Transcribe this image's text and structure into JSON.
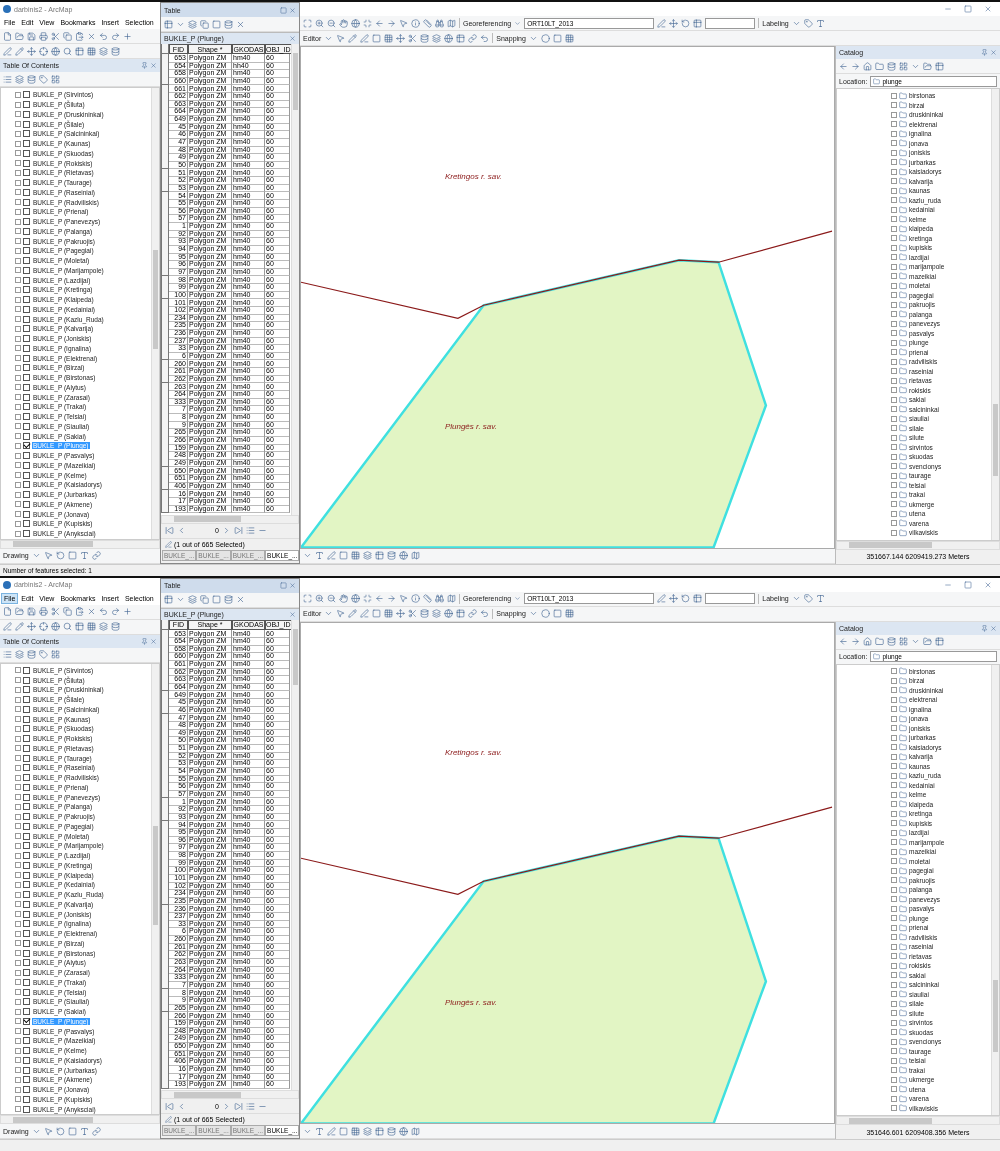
{
  "screens": [
    {
      "title": "darbinis2 - ArcMap",
      "menu": [
        {
          "label": "File",
          "selected": false
        },
        {
          "label": "Edit",
          "selected": false
        },
        {
          "label": "View",
          "selected": false
        },
        {
          "label": "Bookmarks",
          "selected": false
        },
        {
          "label": "Insert",
          "selected": false
        },
        {
          "label": "Selection",
          "selected": false
        }
      ],
      "toc": {
        "title": "Table Of Contents",
        "layers": [
          {
            "label": "BUKLE_P (Sirvintos)",
            "checked": false,
            "selected": false
          },
          {
            "label": "BUKLE_P (Šiluta)",
            "checked": false,
            "selected": false
          },
          {
            "label": "BUKLE_P (Druskininkai)",
            "checked": false,
            "selected": false
          },
          {
            "label": "BUKLE_P (Šilale)",
            "checked": false,
            "selected": false
          },
          {
            "label": "BUKLE_P (Salcininkai)",
            "checked": false,
            "selected": false
          },
          {
            "label": "BUKLE_P (Kaunas)",
            "checked": false,
            "selected": false
          },
          {
            "label": "BUKLE_P (Skuodas)",
            "checked": false,
            "selected": false
          },
          {
            "label": "BUKLE_P (Rokiskis)",
            "checked": false,
            "selected": false
          },
          {
            "label": "BUKLE_P (Rietavas)",
            "checked": false,
            "selected": false
          },
          {
            "label": "BUKLE_P (Taurage)",
            "checked": false,
            "selected": false
          },
          {
            "label": "BUKLE_P (Raseiniai)",
            "checked": false,
            "selected": false
          },
          {
            "label": "BUKLE_P (Radviliskis)",
            "checked": false,
            "selected": false
          },
          {
            "label": "BUKLE_P (Prienai)",
            "checked": false,
            "selected": false
          },
          {
            "label": "BUKLE_P (Panevezys)",
            "checked": false,
            "selected": false
          },
          {
            "label": "BUKLE_P (Palanga)",
            "checked": false,
            "selected": false
          },
          {
            "label": "BUKLE_P (Pakruojis)",
            "checked": false,
            "selected": false
          },
          {
            "label": "BUKLE_P (Pagegiai)",
            "checked": false,
            "selected": false
          },
          {
            "label": "BUKLE_P (Moletai)",
            "checked": false,
            "selected": false
          },
          {
            "label": "BUKLE_P (Marijampole)",
            "checked": false,
            "selected": false
          },
          {
            "label": "BUKLE_P (Lazdijai)",
            "checked": false,
            "selected": false
          },
          {
            "label": "BUKLE_P (Kretinga)",
            "checked": false,
            "selected": false
          },
          {
            "label": "BUKLE_P (Klaipeda)",
            "checked": false,
            "selected": false
          },
          {
            "label": "BUKLE_P (Kedainiai)",
            "checked": false,
            "selected": false
          },
          {
            "label": "BUKLE_P (Kazlu_Ruda)",
            "checked": false,
            "selected": false
          },
          {
            "label": "BUKLE_P (Kalvarija)",
            "checked": false,
            "selected": false
          },
          {
            "label": "BUKLE_P (Joniskis)",
            "checked": false,
            "selected": false
          },
          {
            "label": "BUKLE_P (Ignalina)",
            "checked": false,
            "selected": false
          },
          {
            "label": "BUKLE_P (Elektrenai)",
            "checked": false,
            "selected": false
          },
          {
            "label": "BUKLE_P (Birzai)",
            "checked": false,
            "selected": false
          },
          {
            "label": "BUKLE_P (Birstonas)",
            "checked": false,
            "selected": false
          },
          {
            "label": "BUKLE_P (Alytus)",
            "checked": false,
            "selected": false
          },
          {
            "label": "BUKLE_P (Zarasai)",
            "checked": false,
            "selected": false
          },
          {
            "label": "BUKLE_P (Trakai)",
            "checked": false,
            "selected": false
          },
          {
            "label": "BUKLE_P (Telsiai)",
            "checked": false,
            "selected": false
          },
          {
            "label": "BUKLE_P (Siauliai)",
            "checked": false,
            "selected": false
          },
          {
            "label": "BUKLE_P (Sakiai)",
            "checked": false,
            "selected": false
          },
          {
            "label": "BUKLE_P (Plunge)",
            "checked": true,
            "selected": true
          },
          {
            "label": "BUKLE_P (Pasvalys)",
            "checked": false,
            "selected": false
          },
          {
            "label": "BUKLE_P (Mazeikiai)",
            "checked": false,
            "selected": false
          },
          {
            "label": "BUKLE_P (Kelme)",
            "checked": false,
            "selected": false
          },
          {
            "label": "BUKLE_P (Kaisiadorys)",
            "checked": false,
            "selected": false
          },
          {
            "label": "BUKLE_P (Jurbarkas)",
            "checked": false,
            "selected": false
          },
          {
            "label": "BUKLE_P (Akmene)",
            "checked": false,
            "selected": false
          },
          {
            "label": "BUKLE_P (Jonava)",
            "checked": false,
            "selected": false
          },
          {
            "label": "BUKLE_P (Kupiskis)",
            "checked": false,
            "selected": false
          },
          {
            "label": "BUKLE_P (Anyksciai)",
            "checked": false,
            "selected": false
          }
        ]
      },
      "table": {
        "window_title": "Table",
        "name": "BUKLE_P (Plunge)",
        "columns": [
          "FID",
          "Shape *",
          "GKODAS",
          "OBJ_ID"
        ],
        "rows": [
          [
            "653",
            "Polygon ZM",
            "hm40",
            "60"
          ],
          [
            "654",
            "Polygon ZM",
            "hh40",
            "60"
          ],
          [
            "658",
            "Polygon ZM",
            "hm40",
            "60"
          ],
          [
            "660",
            "Polygon ZM",
            "hm40",
            "60"
          ],
          [
            "661",
            "Polygon ZM",
            "hm40",
            "60"
          ],
          [
            "662",
            "Polygon ZM",
            "hm40",
            "60"
          ],
          [
            "663",
            "Polygon ZM",
            "hm40",
            "60"
          ],
          [
            "664",
            "Polygon ZM",
            "hm40",
            "60"
          ],
          [
            "649",
            "Polygon ZM",
            "hm40",
            "60"
          ],
          [
            "45",
            "Polygon ZM",
            "hm40",
            "60"
          ],
          [
            "46",
            "Polygon ZM",
            "hm40",
            "60"
          ],
          [
            "47",
            "Polygon ZM",
            "hm40",
            "60"
          ],
          [
            "48",
            "Polygon ZM",
            "hm40",
            "60"
          ],
          [
            "49",
            "Polygon ZM",
            "hm40",
            "60"
          ],
          [
            "50",
            "Polygon ZM",
            "hm40",
            "60"
          ],
          [
            "51",
            "Polygon ZM",
            "hm40",
            "60"
          ],
          [
            "52",
            "Polygon ZM",
            "hm40",
            "60"
          ],
          [
            "53",
            "Polygon ZM",
            "hm40",
            "60"
          ],
          [
            "54",
            "Polygon ZM",
            "hm40",
            "60"
          ],
          [
            "55",
            "Polygon ZM",
            "hm40",
            "60"
          ],
          [
            "56",
            "Polygon ZM",
            "hm40",
            "60"
          ],
          [
            "57",
            "Polygon ZM",
            "hm40",
            "60"
          ],
          [
            "1",
            "Polygon ZM",
            "hm40",
            "60"
          ],
          [
            "92",
            "Polygon ZM",
            "hm40",
            "60"
          ],
          [
            "93",
            "Polygon ZM",
            "hm40",
            "60"
          ],
          [
            "94",
            "Polygon ZM",
            "hm40",
            "60"
          ],
          [
            "95",
            "Polygon ZM",
            "hm40",
            "60"
          ],
          [
            "96",
            "Polygon ZM",
            "hm40",
            "60"
          ],
          [
            "97",
            "Polygon ZM",
            "hm40",
            "60"
          ],
          [
            "98",
            "Polygon ZM",
            "hm40",
            "60"
          ],
          [
            "99",
            "Polygon ZM",
            "hm40",
            "60"
          ],
          [
            "100",
            "Polygon ZM",
            "hm40",
            "60"
          ],
          [
            "101",
            "Polygon ZM",
            "hm40",
            "60"
          ],
          [
            "102",
            "Polygon ZM",
            "hm40",
            "60"
          ],
          [
            "234",
            "Polygon ZM",
            "hm40",
            "60"
          ],
          [
            "235",
            "Polygon ZM",
            "hm40",
            "60"
          ],
          [
            "236",
            "Polygon ZM",
            "hm40",
            "60"
          ],
          [
            "237",
            "Polygon ZM",
            "hm40",
            "60"
          ],
          [
            "33",
            "Polygon ZM",
            "hm40",
            "60"
          ],
          [
            "6",
            "Polygon ZM",
            "hm40",
            "60"
          ],
          [
            "260",
            "Polygon ZM",
            "hm40",
            "60"
          ],
          [
            "261",
            "Polygon ZM",
            "hm40",
            "60"
          ],
          [
            "262",
            "Polygon ZM",
            "hm40",
            "60"
          ],
          [
            "263",
            "Polygon ZM",
            "hm40",
            "60"
          ],
          [
            "264",
            "Polygon ZM",
            "hm40",
            "60"
          ],
          [
            "333",
            "Polygon ZM",
            "hm40",
            "60"
          ],
          [
            "7",
            "Polygon ZM",
            "hm40",
            "60"
          ],
          [
            "8",
            "Polygon ZM",
            "hm40",
            "60"
          ],
          [
            "9",
            "Polygon ZM",
            "hm40",
            "60"
          ],
          [
            "265",
            "Polygon ZM",
            "hm40",
            "60"
          ],
          [
            "266",
            "Polygon ZM",
            "hm40",
            "60"
          ],
          [
            "159",
            "Polygon ZM",
            "hm40",
            "60"
          ],
          [
            "248",
            "Polygon ZM",
            "hm40",
            "60"
          ],
          [
            "249",
            "Polygon ZM",
            "hm40",
            "60"
          ],
          [
            "650",
            "Polygon ZM",
            "hm40",
            "60"
          ],
          [
            "651",
            "Polygon ZM",
            "hm40",
            "60"
          ],
          [
            "406",
            "Polygon ZM",
            "hm40",
            "60"
          ],
          [
            "16",
            "Polygon ZM",
            "hm40",
            "60"
          ],
          [
            "17",
            "Polygon ZM",
            "hm40",
            "60"
          ],
          [
            "193",
            "Polygon ZM",
            "hm40",
            "60"
          ]
        ],
        "record": "0",
        "selection": "(1 out of 665 Selected)",
        "tabs": [
          {
            "label": "BUKLE_...",
            "selected": false
          },
          {
            "label": "BUKLE_...",
            "selected": false
          },
          {
            "label": "BUKLE_...",
            "selected": false
          },
          {
            "label": "BUKLE_...",
            "selected": true
          }
        ]
      },
      "toolbar": {
        "georeferencing": "Georeferencing",
        "layer": "ORT10LT_2013",
        "labeling": "Labeling",
        "editor": "Editor",
        "snapping": "Snapping",
        "drawing": "Drawing"
      },
      "map": {
        "labels": [
          "Kretingos r. sav.",
          "Plungės r. sav."
        ]
      },
      "catalog": {
        "title": "Catalog",
        "location_label": "Location:",
        "location": "plunge",
        "items": [
          "birstonas",
          "birzai",
          "druskininkai",
          "elektrenai",
          "ignalina",
          "jonava",
          "joniskis",
          "jurbarkas",
          "kaisiadorys",
          "kalvarija",
          "kaunas",
          "kazlu_ruda",
          "kedainiai",
          "kelme",
          "klaipeda",
          "kretinga",
          "kupiskis",
          "lazdijai",
          "marijampole",
          "mazeikiai",
          "moletai",
          "pagegiai",
          "pakruojis",
          "palanga",
          "panevezys",
          "pasvalys",
          "plunge",
          "prienai",
          "radviliskis",
          "raseiniai",
          "rietavas",
          "rokiskis",
          "sakiai",
          "salcininkai",
          "siauliai",
          "silale",
          "silute",
          "sirvintos",
          "skuodas",
          "svencionys",
          "taurage",
          "telsiai",
          "trakai",
          "ukmerge",
          "utena",
          "varena",
          "vilkaviskis"
        ]
      },
      "status": {
        "message": "Number of features selected: 1",
        "coordinates": "351667.144  6209419.273 Meters"
      }
    },
    {
      "title": "darbinis2 - ArcMap",
      "menu": [
        {
          "label": "File",
          "selected": true
        },
        {
          "label": "Edit",
          "selected": false
        },
        {
          "label": "View",
          "selected": false
        },
        {
          "label": "Bookmarks",
          "selected": false
        },
        {
          "label": "Insert",
          "selected": false
        },
        {
          "label": "Selection",
          "selected": false
        }
      ],
      "toc": {
        "title": "Table Of Contents",
        "layers": [
          {
            "label": "BUKLE_P (Sirvintos)",
            "checked": false,
            "selected": false
          },
          {
            "label": "BUKLE_P (Šiluta)",
            "checked": false,
            "selected": false
          },
          {
            "label": "BUKLE_P (Druskininkai)",
            "checked": false,
            "selected": false
          },
          {
            "label": "BUKLE_P (Šilale)",
            "checked": false,
            "selected": false
          },
          {
            "label": "BUKLE_P (Salcininkai)",
            "checked": false,
            "selected": false
          },
          {
            "label": "BUKLE_P (Kaunas)",
            "checked": false,
            "selected": false
          },
          {
            "label": "BUKLE_P (Skuodas)",
            "checked": false,
            "selected": false
          },
          {
            "label": "BUKLE_P (Rokiskis)",
            "checked": false,
            "selected": false
          },
          {
            "label": "BUKLE_P (Rietavas)",
            "checked": false,
            "selected": false
          },
          {
            "label": "BUKLE_P (Taurage)",
            "checked": false,
            "selected": false
          },
          {
            "label": "BUKLE_P (Raseiniai)",
            "checked": false,
            "selected": false
          },
          {
            "label": "BUKLE_P (Radviliskis)",
            "checked": false,
            "selected": false
          },
          {
            "label": "BUKLE_P (Prienai)",
            "checked": false,
            "selected": false
          },
          {
            "label": "BUKLE_P (Panevezys)",
            "checked": false,
            "selected": false
          },
          {
            "label": "BUKLE_P (Palanga)",
            "checked": false,
            "selected": false
          },
          {
            "label": "BUKLE_P (Pakruojis)",
            "checked": false,
            "selected": false
          },
          {
            "label": "BUKLE_P (Pagegiai)",
            "checked": false,
            "selected": false
          },
          {
            "label": "BUKLE_P (Moletai)",
            "checked": false,
            "selected": false
          },
          {
            "label": "BUKLE_P (Marijampole)",
            "checked": false,
            "selected": false
          },
          {
            "label": "BUKLE_P (Lazdijai)",
            "checked": false,
            "selected": false
          },
          {
            "label": "BUKLE_P (Kretinga)",
            "checked": false,
            "selected": false
          },
          {
            "label": "BUKLE_P (Klaipeda)",
            "checked": false,
            "selected": false
          },
          {
            "label": "BUKLE_P (Kedainiai)",
            "checked": false,
            "selected": false
          },
          {
            "label": "BUKLE_P (Kazlu_Ruda)",
            "checked": false,
            "selected": false
          },
          {
            "label": "BUKLE_P (Kalvarija)",
            "checked": false,
            "selected": false
          },
          {
            "label": "BUKLE_P (Joniskis)",
            "checked": false,
            "selected": false
          },
          {
            "label": "BUKLE_P (Ignalina)",
            "checked": false,
            "selected": false
          },
          {
            "label": "BUKLE_P (Elektrenai)",
            "checked": false,
            "selected": false
          },
          {
            "label": "BUKLE_P (Birzai)",
            "checked": false,
            "selected": false
          },
          {
            "label": "BUKLE_P (Birstonas)",
            "checked": false,
            "selected": false
          },
          {
            "label": "BUKLE_P (Alytus)",
            "checked": false,
            "selected": false
          },
          {
            "label": "BUKLE_P (Zarasai)",
            "checked": false,
            "selected": false
          },
          {
            "label": "BUKLE_P (Trakai)",
            "checked": false,
            "selected": false
          },
          {
            "label": "BUKLE_P (Telsiai)",
            "checked": false,
            "selected": false
          },
          {
            "label": "BUKLE_P (Siauliai)",
            "checked": false,
            "selected": false
          },
          {
            "label": "BUKLE_P (Sakiai)",
            "checked": false,
            "selected": false
          },
          {
            "label": "BUKLE_P (Plunge)",
            "checked": true,
            "selected": true
          },
          {
            "label": "BUKLE_P (Pasvalys)",
            "checked": false,
            "selected": false
          },
          {
            "label": "BUKLE_P (Mazeikiai)",
            "checked": false,
            "selected": false
          },
          {
            "label": "BUKLE_P (Kelme)",
            "checked": false,
            "selected": false
          },
          {
            "label": "BUKLE_P (Kaisiadorys)",
            "checked": false,
            "selected": false
          },
          {
            "label": "BUKLE_P (Jurbarkas)",
            "checked": false,
            "selected": false
          },
          {
            "label": "BUKLE_P (Akmene)",
            "checked": false,
            "selected": false
          },
          {
            "label": "BUKLE_P (Jonava)",
            "checked": false,
            "selected": false
          },
          {
            "label": "BUKLE_P (Kupiskis)",
            "checked": false,
            "selected": false
          },
          {
            "label": "BUKLE_P (Anyksciai)",
            "checked": false,
            "selected": false
          }
        ]
      },
      "table": {
        "window_title": "Table",
        "name": "BUKLE_P (Plunge)",
        "columns": [
          "FID",
          "Shape *",
          "GKODAS",
          "OBJ_ID"
        ],
        "rows": [
          [
            "653",
            "Polygon ZM",
            "hm40",
            "60"
          ],
          [
            "654",
            "Polygon ZM",
            "hm40",
            "60"
          ],
          [
            "658",
            "Polygon ZM",
            "hm40",
            "60"
          ],
          [
            "660",
            "Polygon ZM",
            "hm40",
            "60"
          ],
          [
            "661",
            "Polygon ZM",
            "hm40",
            "60"
          ],
          [
            "662",
            "Polygon ZM",
            "hm40",
            "60"
          ],
          [
            "663",
            "Polygon ZM",
            "hm40",
            "60"
          ],
          [
            "664",
            "Polygon ZM",
            "hm40",
            "60"
          ],
          [
            "649",
            "Polygon ZM",
            "hm40",
            "60"
          ],
          [
            "45",
            "Polygon ZM",
            "hm40",
            "60"
          ],
          [
            "46",
            "Polygon ZM",
            "hm40",
            "60"
          ],
          [
            "47",
            "Polygon ZM",
            "hm40",
            "60"
          ],
          [
            "48",
            "Polygon ZM",
            "hm40",
            "60"
          ],
          [
            "49",
            "Polygon ZM",
            "hm40",
            "60"
          ],
          [
            "50",
            "Polygon ZM",
            "hm40",
            "60"
          ],
          [
            "51",
            "Polygon ZM",
            "hm40",
            "60"
          ],
          [
            "52",
            "Polygon ZM",
            "hm40",
            "60"
          ],
          [
            "53",
            "Polygon ZM",
            "hm40",
            "60"
          ],
          [
            "54",
            "Polygon ZM",
            "hm40",
            "60"
          ],
          [
            "55",
            "Polygon ZM",
            "hm40",
            "60"
          ],
          [
            "56",
            "Polygon ZM",
            "hm40",
            "60"
          ],
          [
            "57",
            "Polygon ZM",
            "hm40",
            "60"
          ],
          [
            "1",
            "Polygon ZM",
            "hm40",
            "60"
          ],
          [
            "92",
            "Polygon ZM",
            "hm40",
            "60"
          ],
          [
            "93",
            "Polygon ZM",
            "hm40",
            "60"
          ],
          [
            "94",
            "Polygon ZM",
            "hm40",
            "60"
          ],
          [
            "95",
            "Polygon ZM",
            "hm40",
            "60"
          ],
          [
            "96",
            "Polygon ZM",
            "hm40",
            "60"
          ],
          [
            "97",
            "Polygon ZM",
            "hm40",
            "60"
          ],
          [
            "98",
            "Polygon ZM",
            "hm40",
            "60"
          ],
          [
            "99",
            "Polygon ZM",
            "hm40",
            "60"
          ],
          [
            "100",
            "Polygon ZM",
            "hm40",
            "60"
          ],
          [
            "101",
            "Polygon ZM",
            "hm40",
            "60"
          ],
          [
            "102",
            "Polygon ZM",
            "hm40",
            "60"
          ],
          [
            "234",
            "Polygon ZM",
            "hm40",
            "60"
          ],
          [
            "235",
            "Polygon ZM",
            "hm40",
            "60"
          ],
          [
            "236",
            "Polygon ZM",
            "hm40",
            "60"
          ],
          [
            "237",
            "Polygon ZM",
            "hm40",
            "60"
          ],
          [
            "33",
            "Polygon ZM",
            "hm40",
            "60"
          ],
          [
            "6",
            "Polygon ZM",
            "hm40",
            "60"
          ],
          [
            "260",
            "Polygon ZM",
            "hm40",
            "60"
          ],
          [
            "261",
            "Polygon ZM",
            "hm40",
            "60"
          ],
          [
            "262",
            "Polygon ZM",
            "hm40",
            "60"
          ],
          [
            "263",
            "Polygon ZM",
            "hm40",
            "60"
          ],
          [
            "264",
            "Polygon ZM",
            "hm40",
            "60"
          ],
          [
            "333",
            "Polygon ZM",
            "hm40",
            "60"
          ],
          [
            "7",
            "Polygon ZM",
            "hm40",
            "60"
          ],
          [
            "8",
            "Polygon ZM",
            "hm40",
            "60"
          ],
          [
            "9",
            "Polygon ZM",
            "hm40",
            "60"
          ],
          [
            "265",
            "Polygon ZM",
            "hm40",
            "60"
          ],
          [
            "266",
            "Polygon ZM",
            "hm40",
            "60"
          ],
          [
            "159",
            "Polygon ZM",
            "hm40",
            "60"
          ],
          [
            "248",
            "Polygon ZM",
            "hm40",
            "60"
          ],
          [
            "249",
            "Polygon ZM",
            "hm40",
            "60"
          ],
          [
            "650",
            "Polygon ZM",
            "hm40",
            "60"
          ],
          [
            "651",
            "Polygon ZM",
            "hm40",
            "60"
          ],
          [
            "406",
            "Polygon ZM",
            "hm40",
            "60"
          ],
          [
            "16",
            "Polygon ZM",
            "hm40",
            "60"
          ],
          [
            "17",
            "Polygon ZM",
            "hm40",
            "60"
          ],
          [
            "193",
            "Polygon ZM",
            "hm40",
            "60"
          ]
        ],
        "record": "0",
        "selection": "(1 out of 665 Selected)",
        "tabs": [
          {
            "label": "BUKLE_...",
            "selected": false
          },
          {
            "label": "BUKLE_...",
            "selected": false
          },
          {
            "label": "BUKLE_...",
            "selected": false
          },
          {
            "label": "BUKLE_...",
            "selected": true
          }
        ]
      },
      "toolbar": {
        "georeferencing": "Georeferencing",
        "layer": "ORT10LT_2013",
        "labeling": "Labeling",
        "editor": "Editor",
        "snapping": "Snapping",
        "drawing": "Drawing"
      },
      "map": {
        "labels": [
          "Kretingos r. sav.",
          "Plungės r. sav."
        ]
      },
      "catalog": {
        "title": "Catalog",
        "location_label": "Location:",
        "location": "plunge",
        "items": [
          "birstonas",
          "birzai",
          "druskininkai",
          "elektrenai",
          "ignalina",
          "jonava",
          "joniskis",
          "jurbarkas",
          "kaisiadorys",
          "kalvarija",
          "kaunas",
          "kazlu_ruda",
          "kedainiai",
          "kelme",
          "klaipeda",
          "kretinga",
          "kupiskis",
          "lazdijai",
          "marijampole",
          "mazeikiai",
          "moletai",
          "pagegiai",
          "pakruojis",
          "palanga",
          "panevezys",
          "pasvalys",
          "plunge",
          "prienai",
          "radviliskis",
          "raseiniai",
          "rietavas",
          "rokiskis",
          "sakiai",
          "salcininkai",
          "siauliai",
          "silale",
          "silute",
          "sirvintos",
          "skuodas",
          "svencionys",
          "taurage",
          "telsiai",
          "trakai",
          "ukmerge",
          "utena",
          "varena",
          "vilkaviskis"
        ]
      },
      "status": {
        "coordinates": "351646.601  6209408.356 Meters"
      }
    }
  ]
}
